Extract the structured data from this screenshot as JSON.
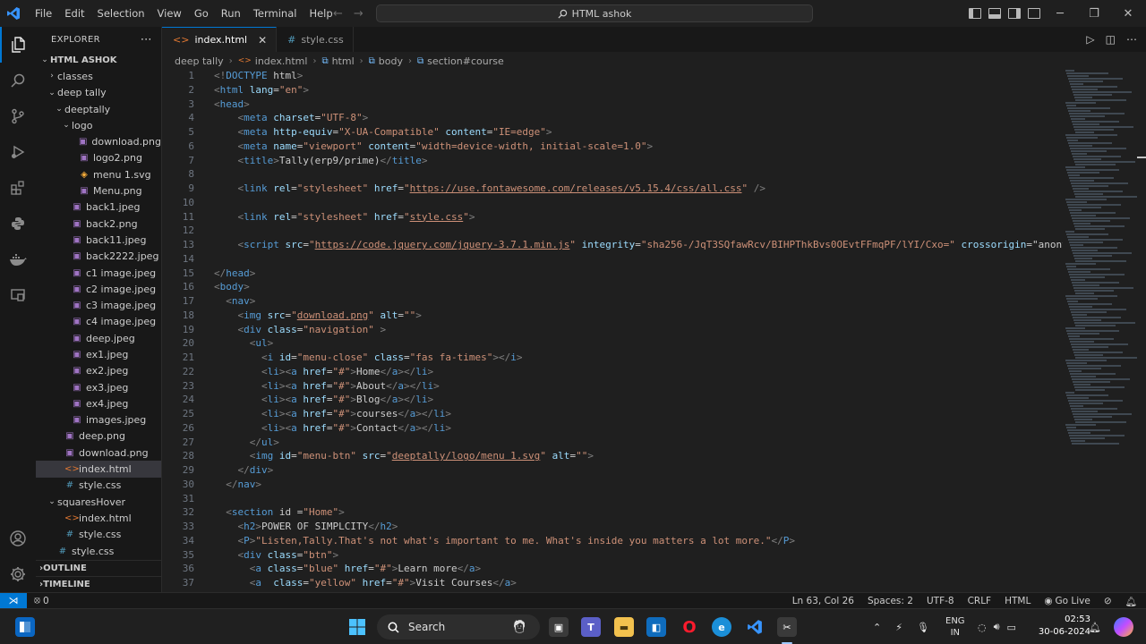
{
  "window": {
    "menu": [
      "File",
      "Edit",
      "Selection",
      "View",
      "Go",
      "Run",
      "Terminal",
      "Help"
    ],
    "search_text": "HTML ashok"
  },
  "sidebar": {
    "title": "EXPLORER",
    "root": "HTML ASHOK",
    "tree": [
      {
        "label": "classes",
        "depth": 1,
        "type": "folder",
        "open": false
      },
      {
        "label": "deep tally",
        "depth": 1,
        "type": "folder",
        "open": true
      },
      {
        "label": "deeptally",
        "depth": 2,
        "type": "folder",
        "open": true
      },
      {
        "label": "logo",
        "depth": 3,
        "type": "folder",
        "open": true
      },
      {
        "label": "download.png",
        "depth": 4,
        "type": "img"
      },
      {
        "label": "logo2.png",
        "depth": 4,
        "type": "img"
      },
      {
        "label": "menu 1.svg",
        "depth": 4,
        "type": "svg"
      },
      {
        "label": "Menu.png",
        "depth": 4,
        "type": "img"
      },
      {
        "label": "back1.jpeg",
        "depth": 3,
        "type": "img"
      },
      {
        "label": "back2.png",
        "depth": 3,
        "type": "img"
      },
      {
        "label": "back11.jpeg",
        "depth": 3,
        "type": "img"
      },
      {
        "label": "back2222.jpeg",
        "depth": 3,
        "type": "img"
      },
      {
        "label": "c1 image.jpeg",
        "depth": 3,
        "type": "img"
      },
      {
        "label": "c2 image.jpeg",
        "depth": 3,
        "type": "img"
      },
      {
        "label": "c3 image.jpeg",
        "depth": 3,
        "type": "img"
      },
      {
        "label": "c4 image.jpeg",
        "depth": 3,
        "type": "img"
      },
      {
        "label": "deep.jpeg",
        "depth": 3,
        "type": "img"
      },
      {
        "label": "ex1.jpeg",
        "depth": 3,
        "type": "img"
      },
      {
        "label": "ex2.jpeg",
        "depth": 3,
        "type": "img"
      },
      {
        "label": "ex3.jpeg",
        "depth": 3,
        "type": "img"
      },
      {
        "label": "ex4.jpeg",
        "depth": 3,
        "type": "img"
      },
      {
        "label": "images.jpeg",
        "depth": 3,
        "type": "img"
      },
      {
        "label": "deep.png",
        "depth": 2,
        "type": "img"
      },
      {
        "label": "download.png",
        "depth": 2,
        "type": "img"
      },
      {
        "label": "index.html",
        "depth": 2,
        "type": "html",
        "selected": true
      },
      {
        "label": "style.css",
        "depth": 2,
        "type": "css"
      },
      {
        "label": "squaresHover",
        "depth": 1,
        "type": "folder",
        "open": true
      },
      {
        "label": "index.html",
        "depth": 2,
        "type": "html"
      },
      {
        "label": "style.css",
        "depth": 2,
        "type": "css"
      },
      {
        "label": "style.css",
        "depth": 1,
        "type": "css"
      }
    ],
    "outline": "OUTLINE",
    "timeline": "TIMELINE"
  },
  "tabs": [
    {
      "label": "index.html",
      "icon": "html",
      "active": true
    },
    {
      "label": "style.css",
      "icon": "css",
      "active": false
    }
  ],
  "breadcrumb": [
    "deep tally",
    "index.html",
    "html",
    "body",
    "section#course"
  ],
  "code_lines": [
    "<!DOCTYPE html>",
    "<html lang=\"en\">",
    "<head>",
    "    <meta charset=\"UTF-8\">",
    "    <meta http-equiv=\"X-UA-Compatible\" content=\"IE=edge\">",
    "    <meta name=\"viewport\" content=\"width=device-width, initial-scale=1.0\">",
    "    <title>Tally(erp9/prime)</title>",
    "",
    "    <link rel=\"stylesheet\" href=\"https://use.fontawesome.com/releases/v5.15.4/css/all.css\" />",
    "",
    "    <link rel=\"stylesheet\" href=\"style.css\">",
    "",
    "    <script src=\"https://code.jquery.com/jquery-3.7.1.min.js\" integrity=\"sha256-/JqT3SQfawRcv/BIHPThkBvs0OEvtFFmqPF/lYI/Cxo=\" crossorigin=\"anonymous",
    "",
    "</head>",
    "<body>",
    "  <nav>",
    "    <img src=\"download.png\" alt=\"\">",
    "    <div class=\"navigation\" >",
    "      <ul>",
    "        <i id=\"menu-close\" class=\"fas fa-times\"></i>",
    "        <li><a href=\"#\">Home</a></li>",
    "        <li><a href=\"#\">About</a></li>",
    "        <li><a href=\"#\">Blog</a></li>",
    "        <li><a href=\"#\">courses</a></li>",
    "        <li><a href=\"#\">Contact</a></li>",
    "      </ul>",
    "      <img id=\"menu-btn\" src=\"deeptally/logo/menu 1.svg\" alt=\"\">",
    "    </div>",
    "  </nav>",
    "",
    "  <section id =\"Home\">",
    "    <h2>POWER OF SIMPLCITY</h2>",
    "    <P>\"Listen,Tally.That's not what's important to me. What's inside you matters a lot more.\"</P>",
    "    <div class=\"btn\">",
    "      <a class=\"blue\" href=\"#\">Learn more</a>",
    "      <a  class=\"yellow\" href=\"#\">Visit Courses</a>"
  ],
  "status": {
    "errors": "0",
    "cursor": "Ln 63, Col 26",
    "spaces": "Spaces: 2",
    "encoding": "UTF-8",
    "eol": "CRLF",
    "language": "HTML",
    "golive": "Go Live"
  },
  "taskbar": {
    "search_label": "Search",
    "lang_top": "ENG",
    "lang_bottom": "IN",
    "time": "02:53",
    "date": "30-06-2024"
  },
  "colors": {
    "accent": "#0078d4",
    "editor_bg": "#1f1f1f",
    "sidebar_bg": "#181818"
  }
}
